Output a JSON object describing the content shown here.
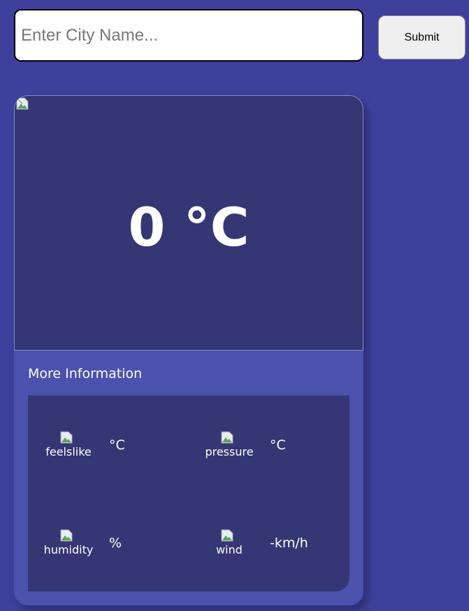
{
  "search": {
    "placeholder": "Enter City Name...",
    "value": "",
    "submit_label": "Submit"
  },
  "weather": {
    "temperature": "0 °C",
    "more_info_title": "More Information",
    "items": [
      {
        "alt": "feelslike",
        "value": "°C",
        "icon": "broken-image-icon"
      },
      {
        "alt": "pressure",
        "value": "°C",
        "icon": "broken-image-icon"
      },
      {
        "alt": "humidity",
        "value": "%",
        "icon": "broken-image-icon"
      },
      {
        "alt": "wind",
        "value": "-km/h",
        "icon": "broken-image-icon"
      }
    ]
  },
  "colors": {
    "page_background": "#3e409c",
    "card_background": "#4a52ad",
    "panel_background": "#353674",
    "text": "#ffffff"
  }
}
